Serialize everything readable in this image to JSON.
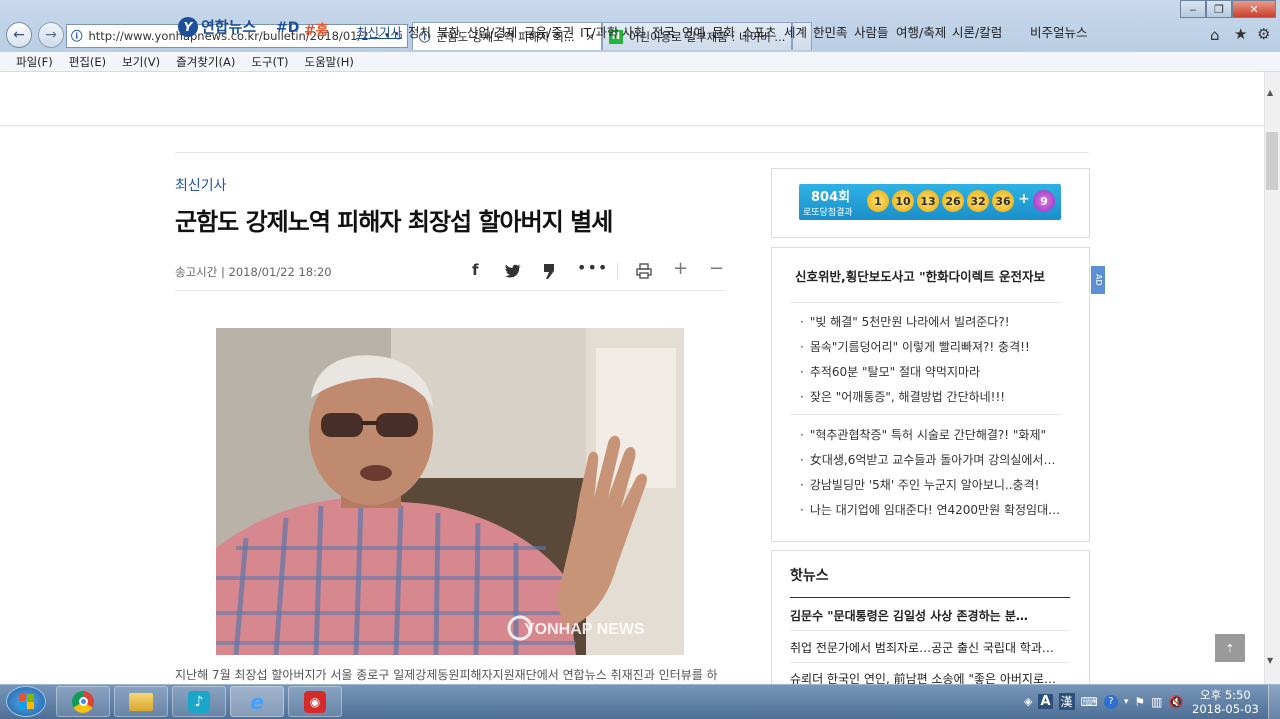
{
  "browser": {
    "url": "http://www.yonhapnews.co.kr/bulletin/2018/01/22/(",
    "url_display": "http://www.yonhapnews.co.kr/bulletin/2018/01/22/(",
    "tab_active": "군함도 강제노역 피해자 최...",
    "tab_inactive": "어린이용로 일부제품 : 네이버 ...",
    "menu": [
      "파일(F)",
      "편집(E)",
      "보기(V)",
      "즐겨찾기(A)",
      "도구(T)",
      "도움말(H)"
    ]
  },
  "site": {
    "logo": "연합뉴스",
    "tag_d": "#D",
    "tag_h": "#흥",
    "nav": [
      "최신기사",
      "정치",
      "북한",
      "산업/경제",
      "금융/증권",
      "IT/과학",
      "사회",
      "전국",
      "연예",
      "문화",
      "스포츠",
      "세계",
      "한민족",
      "사람들",
      "여행/축제",
      "시론/칼럼",
      "비주얼뉴스"
    ]
  },
  "article": {
    "section": "최신기사",
    "headline": "군함도 강제노역 피해자 최장섭 할아버지 별세",
    "meta": "송고시간 | 2018/01/22 18:20",
    "watermark": "YONHAP NEWS",
    "caption": "지난해 7월 최장섭 할아버지가 서울 종로구 일제강제동원피해자지원재단에서 연합뉴스 취재진과 인터뷰를 하"
  },
  "lotto": {
    "round": "804회",
    "label": "로또당첨결과",
    "numbers": [
      "1",
      "10",
      "13",
      "26",
      "32",
      "36"
    ],
    "plus": "+",
    "bonus": "9"
  },
  "ad_box": {
    "title": "신호위반,횡단보도사고 \"한화다이렉트 운전자보",
    "badge": "AD",
    "links_a": [
      "\"빚 해결\" 5천만원 나라에서 빌려준다?!",
      "몸속\"기름덩어리\" 이렇게 빨리빠져?! 충격!!",
      "추적60분 \"탈모\" 절대 약먹지마라",
      "잦은 \"어깨통증\", 해결방법 간단하네!!!"
    ],
    "links_b": [
      "\"혁추관협착증\" 특허 시술로 간단해결?! \"화제\"",
      "女대생,6억받고 교수들과 돌아가며 강의실에서…",
      "강남빌딩만 '5채' 주인 누군지 알아보니..충격!",
      "나는 대기업에 임대준다! 연4200만원 확정임대…"
    ]
  },
  "hot_news": {
    "title": "핫뉴스",
    "items": [
      "김문수 \"문대통령은 김일성 사상 존경하는 분…",
      "취업 전문가에서 범죄자로…공군 출신 국립대 학과…",
      "슈뢰더 한국인 연인, 前남편 소송에 \"좋은 아버지로…"
    ]
  },
  "taskbar": {
    "time": "오후 5:50",
    "date": "2018-05-03",
    "ime": "A",
    "hanja": "漢"
  },
  "colors": {
    "brand": "#1d4f9c",
    "link_blue": "#2157a6",
    "tag_orange": "#e8542c",
    "lotto_bg": "#1c9fd8"
  }
}
